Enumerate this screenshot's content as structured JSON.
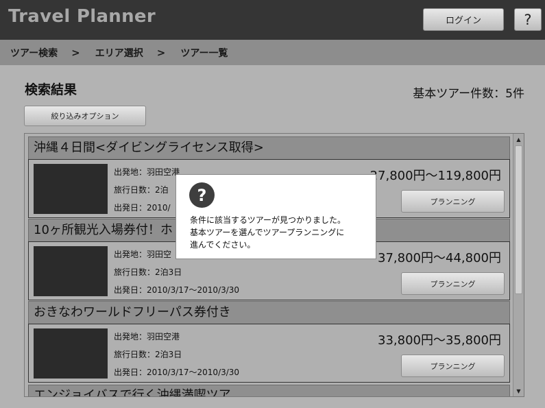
{
  "header": {
    "title": "Travel Planner",
    "login_label": "ログイン",
    "help_label": "?"
  },
  "breadcrumb": {
    "items": [
      "ツアー検索",
      "エリア選択",
      "ツアー一覧"
    ],
    "separator": ">"
  },
  "main": {
    "title": "検索結果",
    "count_text": "基本ツアー件数：5件",
    "filter_label": "絞り込みオプション"
  },
  "results": [
    {
      "title": "沖縄４日間<ダイビングライセンス取得>",
      "departure": "出発地：羽田空港",
      "duration": "旅行日数：2泊",
      "dates": "出発日：2010/",
      "price": "27,800円～119,800円",
      "plan_label": "プランニング"
    },
    {
      "title": "10ヶ所観光入場券付！ホ",
      "departure": "出発地：羽田空",
      "duration": "旅行日数：2泊3日",
      "dates": "出発日：2010/3/17～2010/3/30",
      "price": "37,800円～44,800円",
      "plan_label": "プランニング"
    },
    {
      "title": "おきなわワールドフリーパス券付き",
      "departure": "出発地：羽田空港",
      "duration": "旅行日数：2泊3日",
      "dates": "出発日：2010/3/17～2010/3/30",
      "price": "33,800円～35,800円",
      "plan_label": "プランニング"
    }
  ],
  "partial_result_title": "エンジョイバスで行く沖縄満喫ツア",
  "scrollbar": {
    "up_arrow": "▲",
    "down_arrow": "▼"
  },
  "dialog": {
    "icon": "question-icon",
    "icon_glyph": "?",
    "line1": "条件に該当するツアーが見つかりました。",
    "line2": "基本ツアーを選んでツアープランニングに",
    "line3": "進んでください。"
  },
  "colors": {
    "header_bg": "#353535",
    "breadcrumb_bg": "#8d8d8d",
    "page_bg": "#b3b3b3",
    "dialog_bg": "#ffffff"
  }
}
